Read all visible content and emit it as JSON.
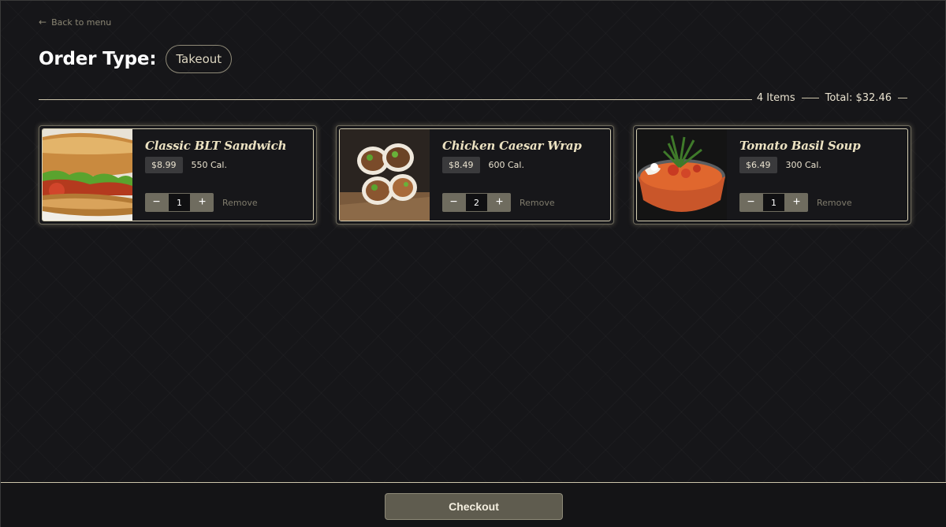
{
  "nav": {
    "back_arrow": "←",
    "back_label": "Back to menu"
  },
  "order": {
    "heading": "Order Type:",
    "type": "Takeout"
  },
  "summary": {
    "items": "4 Items",
    "total": "Total: $32.46"
  },
  "items": [
    {
      "name": "Classic BLT Sandwich",
      "price": "$8.99",
      "calories": "550 Cal.",
      "quantity": "1",
      "remove": "Remove",
      "image_icon": "blt-sandwich-photo"
    },
    {
      "name": "Chicken Caesar Wrap",
      "price": "$8.49",
      "calories": "600 Cal.",
      "quantity": "2",
      "remove": "Remove",
      "image_icon": "chicken-wrap-photo"
    },
    {
      "name": "Tomato Basil Soup",
      "price": "$6.49",
      "calories": "300 Cal.",
      "quantity": "1",
      "remove": "Remove",
      "image_icon": "tomato-soup-photo"
    }
  ],
  "stepper": {
    "minus": "−",
    "plus": "+"
  },
  "footer": {
    "checkout_label": "Checkout"
  },
  "colors": {
    "background": "#161619",
    "accent": "#cdc5ab",
    "title": "#ece2c2",
    "button": "#5f5c4f"
  }
}
